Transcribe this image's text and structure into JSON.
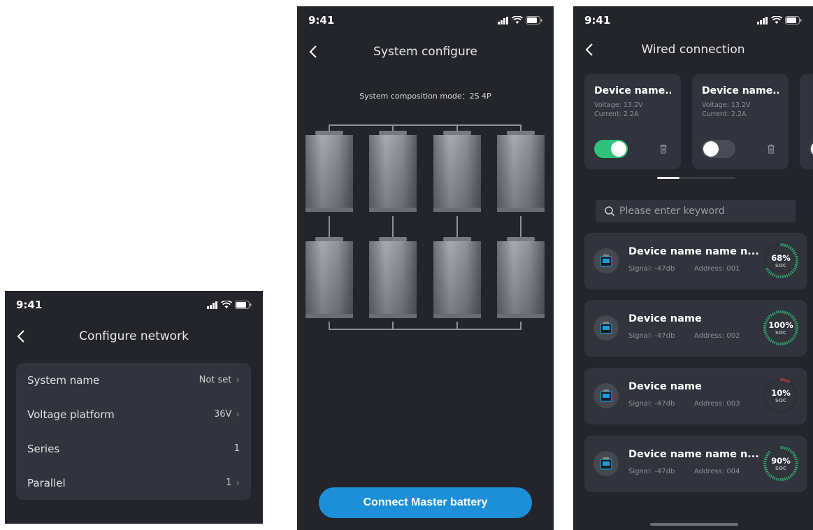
{
  "status_time": "9:41",
  "screen1": {
    "title": "Configure network",
    "rows": [
      {
        "label": "System name",
        "value": "Not set",
        "chevron": true
      },
      {
        "label": "Voltage platform",
        "value": "36V",
        "chevron": true
      },
      {
        "label": "Series",
        "value": "1",
        "chevron": false
      },
      {
        "label": "Parallel",
        "value": "1",
        "chevron": true
      }
    ]
  },
  "screen2": {
    "title": "System configure",
    "mode_text": "System composition mode：2S 4P",
    "button_label": "Connect Master battery",
    "button_color": "#1d8fd8"
  },
  "screen3": {
    "title": "Wired connection",
    "devices": [
      {
        "name": "Device name...",
        "voltage": "Voltage: 13.2V",
        "current": "Current: 2.2A",
        "on": true
      },
      {
        "name": "Device name...",
        "voltage": "Voltage: 13.2V",
        "current": "Current: 2.2A",
        "on": false
      }
    ],
    "search_placeholder": "Please enter keyword",
    "list": [
      {
        "name": "Device name name n...",
        "signal": "Signal: -47db",
        "address": "Address: 001",
        "soc": "68%",
        "soc_value": 0.68,
        "color": "#2fc27a"
      },
      {
        "name": "Device name",
        "signal": "Signal: -47db",
        "address": "Address: 002",
        "soc": "100%",
        "soc_value": 1.0,
        "color": "#2fc27a"
      },
      {
        "name": "Device name",
        "signal": "Signal: -47db",
        "address": "Address: 003",
        "soc": "10%",
        "soc_value": 0.1,
        "color": "#e0463a"
      },
      {
        "name": "Device name name n...",
        "signal": "Signal: -47db",
        "address": "Address: 004",
        "soc": "90%",
        "soc_value": 0.9,
        "color": "#2fc27a"
      }
    ],
    "soc_label": "SOC",
    "accent": "#2fc27a"
  }
}
